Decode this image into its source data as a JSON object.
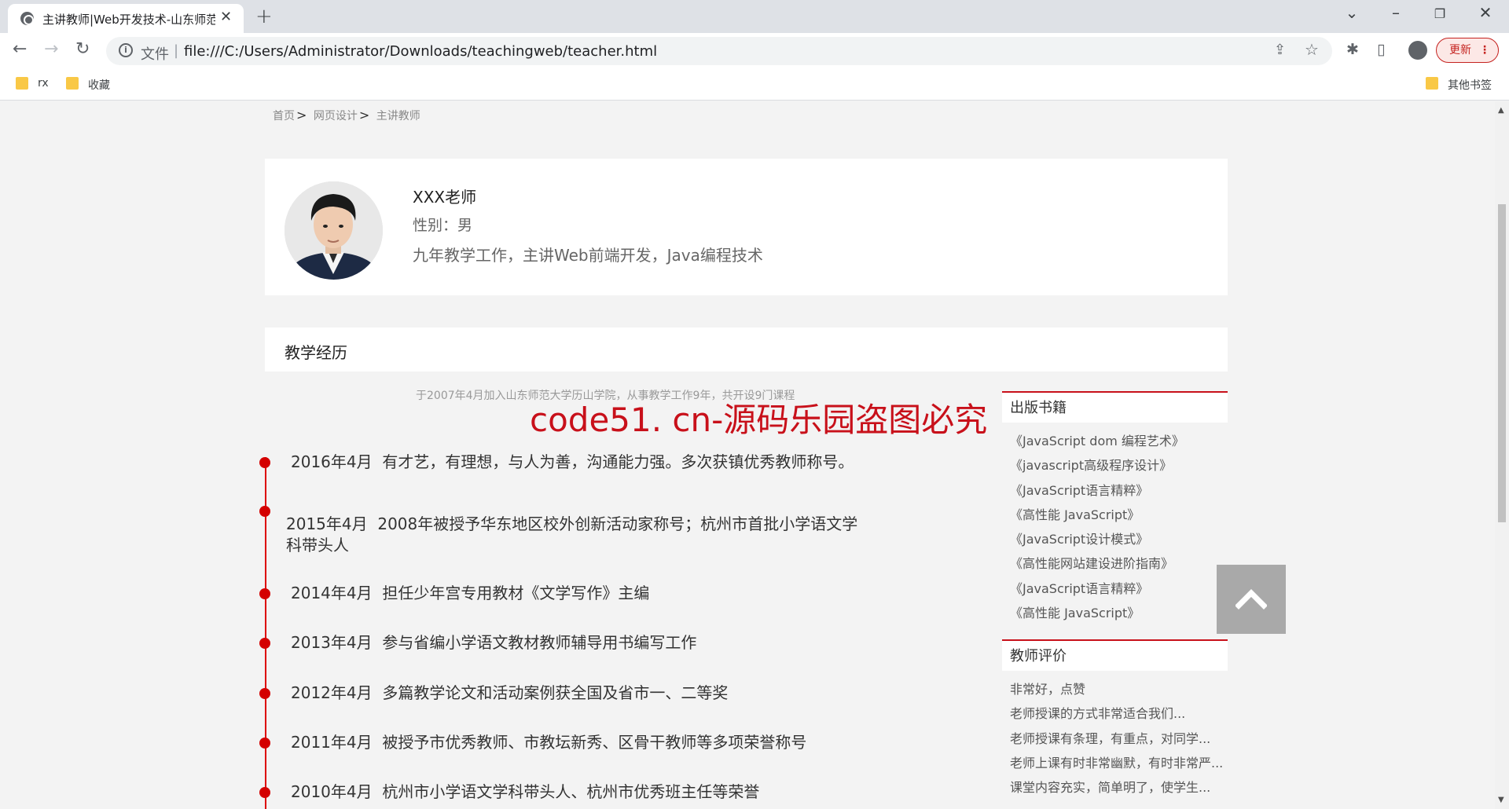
{
  "browser": {
    "tab_title": "主讲教师|Web开发技术-山东师范",
    "url_scheme": "文件",
    "url": "file:///C:/Users/Administrator/Downloads/teachingweb/teacher.html",
    "update_label": "更新",
    "bookmarks": [
      "rx",
      "收藏"
    ],
    "other_bookmarks": "其他书签"
  },
  "breadcrumb": [
    "首页",
    "网页设计",
    "主讲教师"
  ],
  "teacher": {
    "name": "XXX老师",
    "gender": "性别：男",
    "description": "九年教学工作，主讲Web前端开发，Java编程技术"
  },
  "experience": {
    "heading": "教学经历",
    "intro": "于2007年4月加入山东师范大学历山学院，从事教学工作9年，共开设9门课程",
    "items": [
      {
        "date": "2016年4月",
        "text": "有才艺，有理想，与人为善，沟通能力强。多次获镇优秀教师称号。"
      },
      {
        "date": "2015年4月",
        "text": "2008年被授予华东地区校外创新活动家称号；杭州市首批小学语文学科带头人"
      },
      {
        "date": "2014年4月",
        "text": "担任少年宫专用教材《文学写作》主编"
      },
      {
        "date": "2013年4月",
        "text": "参与省编小学语文教材教师辅导用书编写工作"
      },
      {
        "date": "2012年4月",
        "text": "多篇教学论文和活动案例获全国及省市一、二等奖"
      },
      {
        "date": "2011年4月",
        "text": "被授予市优秀教师、市教坛新秀、区骨干教师等多项荣誉称号"
      },
      {
        "date": "2010年4月",
        "text": "杭州市小学语文学科带头人、杭州市优秀班主任等荣誉"
      }
    ]
  },
  "books": {
    "heading": "出版书籍",
    "items": [
      "《JavaScript dom 编程艺术》",
      "《javascript高级程序设计》",
      "《JavaScript语言精粹》",
      "《高性能 JavaScript》",
      "《JavaScript设计模式》",
      "《高性能网站建设进阶指南》",
      "《JavaScript语言精粹》",
      "《高性能 JavaScript》"
    ]
  },
  "reviews": {
    "heading": "教师评价",
    "items": [
      "非常好，点赞",
      "老师授课的方式非常适合我们...",
      "老师授课有条理，有重点，对同学...",
      "老师上课有时非常幽默，有时非常严...",
      "课堂内容充实，简单明了，使学生..."
    ]
  },
  "watermark": "code51. cn-源码乐园盗图必究",
  "colors": {
    "accent": "#c8101a",
    "timeline_dot": "#d40000",
    "page_bg": "#f3f3f3"
  }
}
